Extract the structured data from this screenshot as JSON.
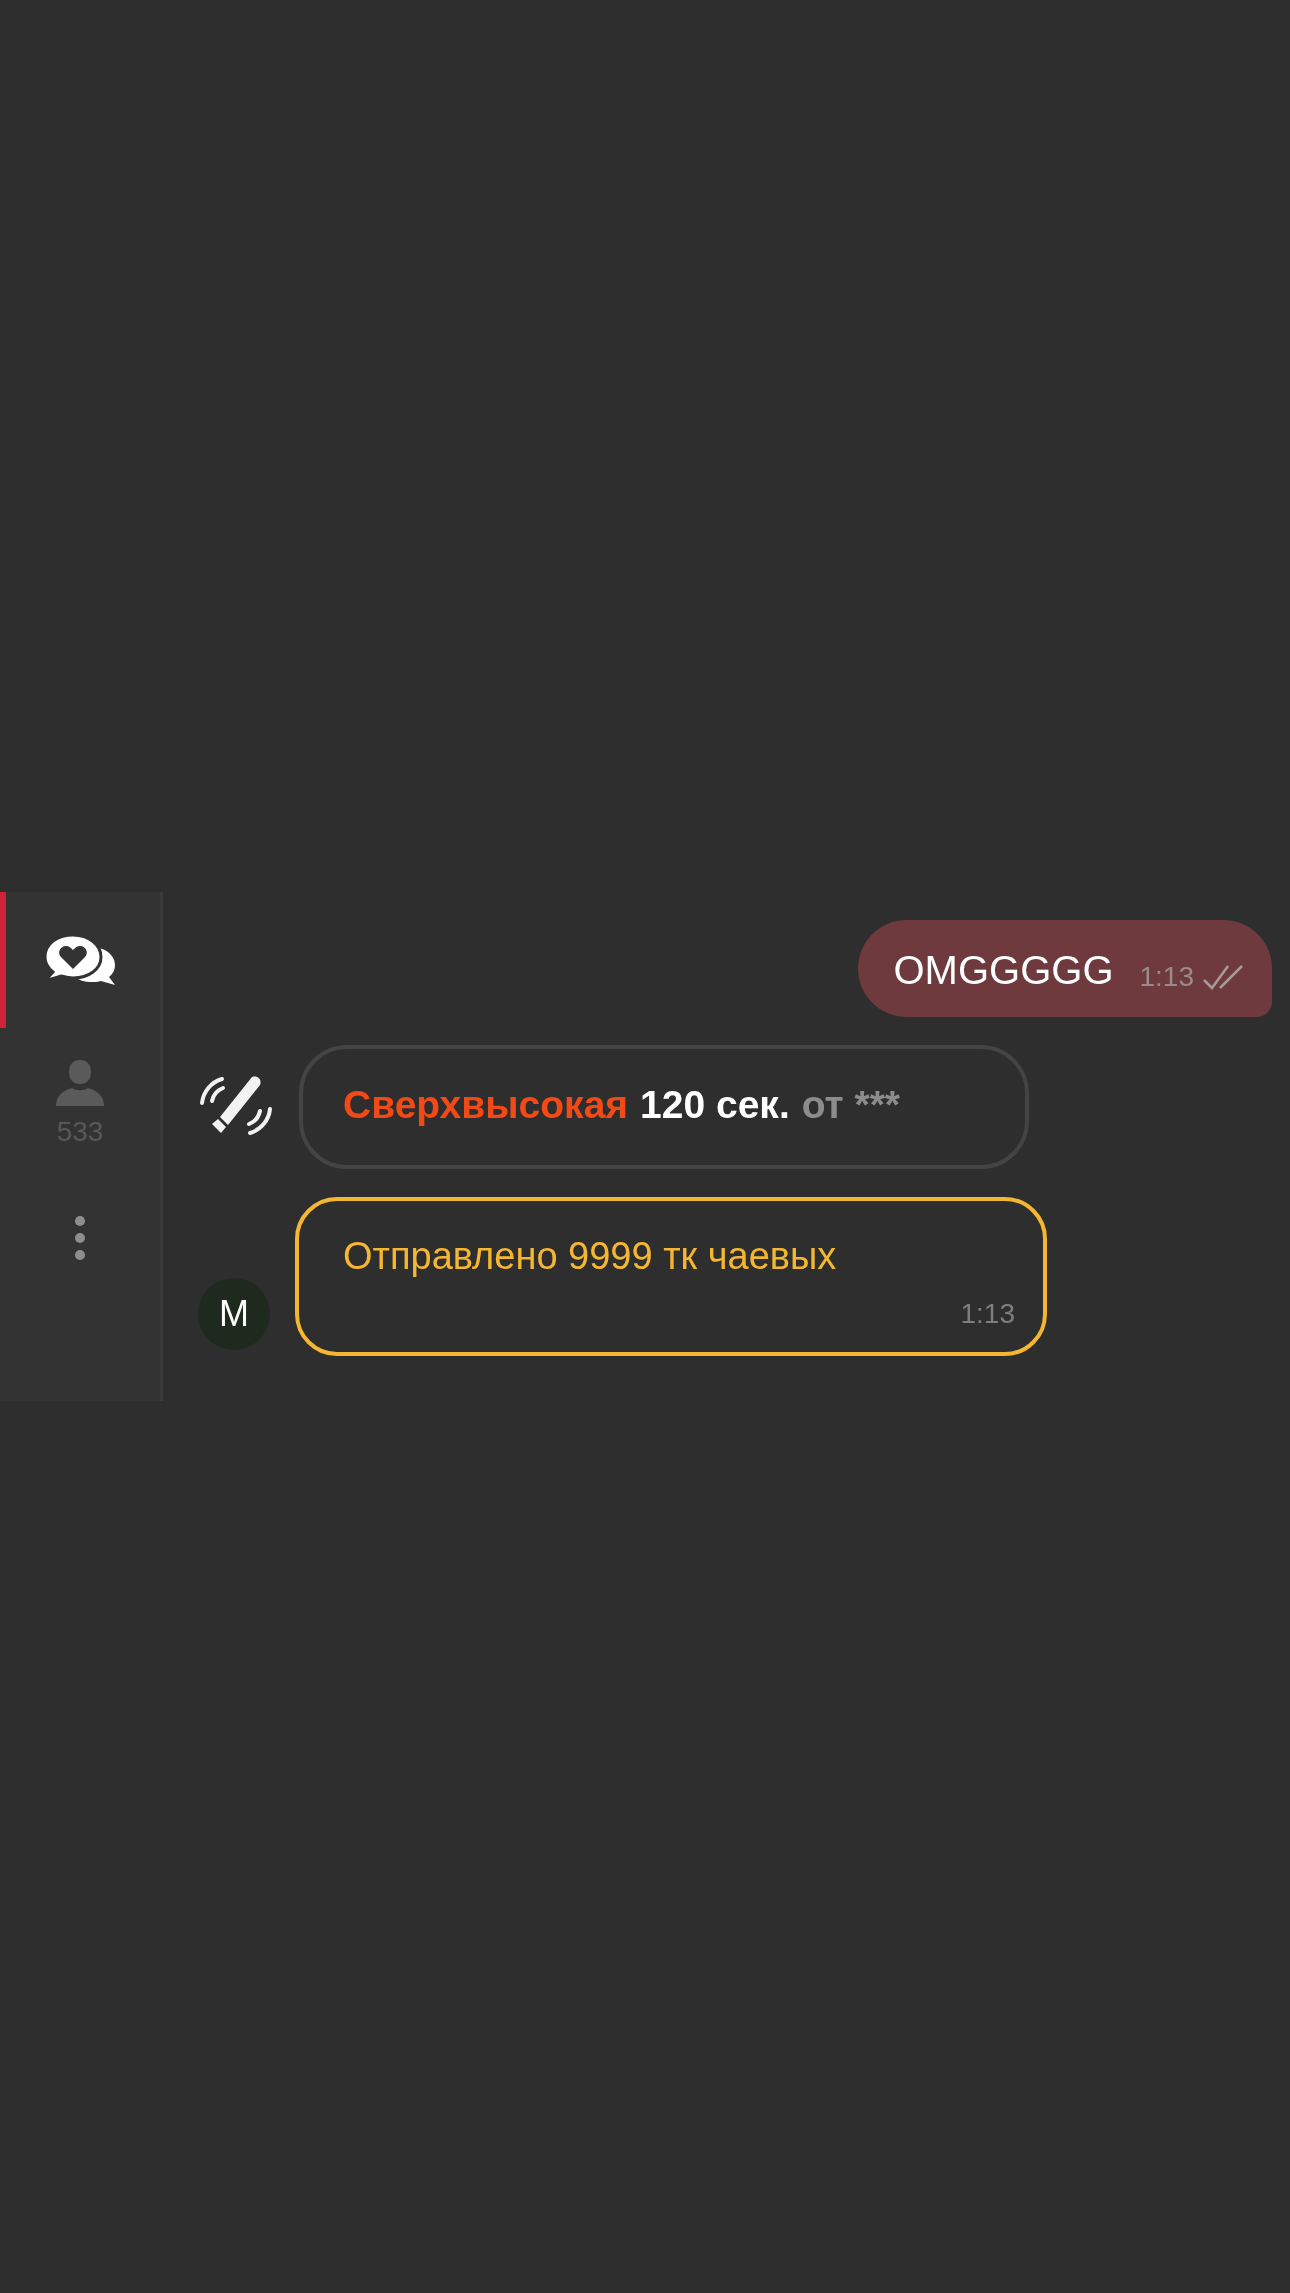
{
  "sidebar": {
    "items": [
      {
        "kind": "chat",
        "selected": true
      },
      {
        "kind": "users",
        "selected": false,
        "count": "533"
      },
      {
        "kind": "more",
        "selected": false
      }
    ]
  },
  "messages": [
    {
      "kind": "outgoing",
      "text": "OMGGGGG",
      "time": "1:13",
      "read": true
    },
    {
      "kind": "vibration",
      "parts": [
        {
          "kind": "level",
          "text": "Сверхвысокая"
        },
        {
          "kind": "duration",
          "text": "120 сек."
        },
        {
          "kind": "sender",
          "text": "от ***"
        }
      ]
    },
    {
      "kind": "tip",
      "avatar": "M",
      "text": "Отправлено 9999 тк чаевых",
      "time": "1:13"
    }
  ]
}
